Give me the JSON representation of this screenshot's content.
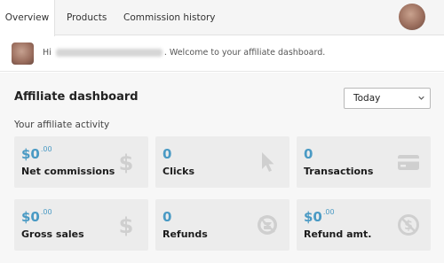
{
  "tabs": [
    {
      "label": "Overview"
    },
    {
      "label": "Products"
    },
    {
      "label": "Commission history"
    }
  ],
  "welcome": {
    "greeting": "Hi",
    "message": ". Welcome to your affiliate dashboard."
  },
  "dashboard": {
    "title": "Affiliate dashboard",
    "period_selected": "Today",
    "activity_label": "Your affiliate activity"
  },
  "cards": [
    {
      "value_main": "$0",
      "value_cents": ".00",
      "label": "Net commissions",
      "icon": "dollar-icon"
    },
    {
      "value_main": "0",
      "value_cents": "",
      "label": "Clicks",
      "icon": "cursor-icon"
    },
    {
      "value_main": "0",
      "value_cents": "",
      "label": "Transactions",
      "icon": "credit-card-icon"
    },
    {
      "value_main": "$0",
      "value_cents": ".00",
      "label": "Gross sales",
      "icon": "dollar-icon"
    },
    {
      "value_main": "0",
      "value_cents": "",
      "label": "Refunds",
      "icon": "refund-icon"
    },
    {
      "value_main": "$0",
      "value_cents": ".00",
      "label": "Refund amt.",
      "icon": "no-dollar-icon"
    }
  ],
  "colors": {
    "accent": "#4a9ac4",
    "card_bg": "#ececec",
    "icon_gray": "#c9c9c9"
  }
}
